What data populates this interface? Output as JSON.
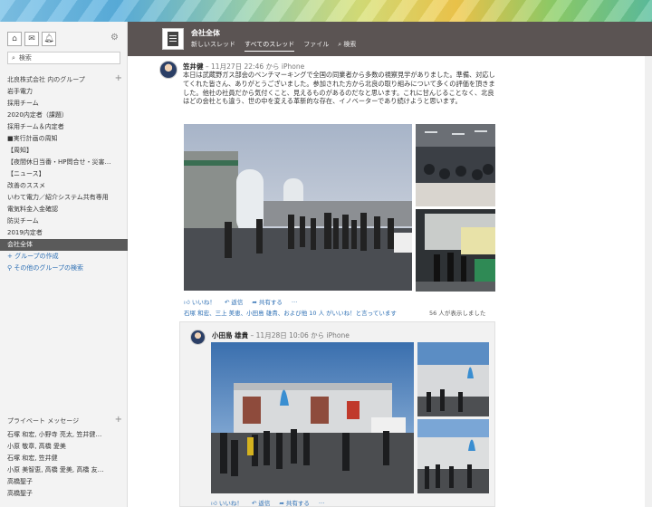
{
  "sidebar": {
    "search_placeholder": "検索",
    "groups_header": "北良株式会社 内のグループ",
    "groups": [
      "岩手電力",
      "採用チーム",
      "2020内定者（課題）",
      "採用チーム＆内定者",
      "■実行計画の周知",
      "【周知】",
      "【夜間休日当番・HP問合せ・災害…",
      "【ニュース】",
      "改善のススメ",
      "いわて電力／紹介システム共有専用",
      "電気料金入金確認",
      "防災チーム",
      "2019内定者",
      "会社全体"
    ],
    "active_group": 13,
    "create_group": "+ グループの作成",
    "browse_groups": "その他のグループの検索",
    "messages_header": "プライベート メッセージ",
    "messages": [
      "石塚 和宏, 小野寺 亮太, 笠井健…",
      "小原 敬章, 高橋 愛美",
      "石塚 和宏, 笠井健",
      "小原 美智恵, 高橋 愛美, 高橋 友…",
      "高橋聖子",
      "高橋聖子"
    ]
  },
  "topbar": {
    "title": "会社全体",
    "tabs": [
      "新しいスレッド",
      "すべてのスレッド",
      "ファイル",
      "検索"
    ]
  },
  "post": {
    "author": "笠井健",
    "meta": "– 11月27日 22:46 から iPhone",
    "text": "本日は武蔵野ガス部会のベンチマーキングで全国の同業者から多数の視察見学がありました。準備、対応してくれた皆さん、ありがとうございました。参加された方から北良の取り組みについて多くの評価を頂きました。他社の社員だから気付くこと、見えるものがあるのだなと思います。これに甘んじることなく、北良はどの会社とも違う、世の中を変える革新的な存在、イノベーターであり続けようと思います。",
    "actions": [
      "いいね！",
      "返信",
      "共有する",
      "…"
    ],
    "likes_text": "石塚 和宏、三上 美恵、小田島 雄貴、および他 10 人 がいいね！と言っています",
    "views": "56 人が表示しました"
  },
  "reply": {
    "author": "小田島 雄貴",
    "meta": "– 11月28日 10:06 から iPhone",
    "actions": [
      "いいね！",
      "返信",
      "共有する",
      "…"
    ]
  },
  "colors": {
    "topbar": "#5b5453",
    "link": "#2d6fb4",
    "active": "#5a5a5a"
  }
}
